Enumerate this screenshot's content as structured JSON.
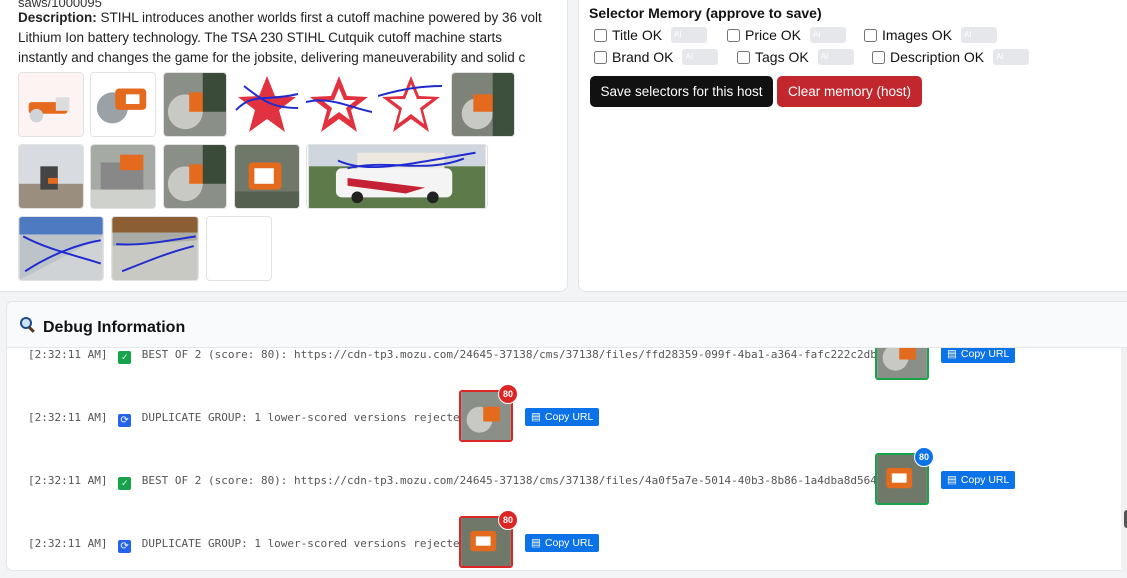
{
  "product": {
    "crop_line": "saws/1000095",
    "description_label": "Description:",
    "description_text": " STIHL introduces another worlds first a cutoff machine powered by 36 volt Lithium Ion battery technology. The TSA 230 STIHL Cutquik cutoff machine starts instantly and changes the game for the jobsite, delivering maneuverability and solid c"
  },
  "selector_memory": {
    "title": "Selector Memory (approve to save)",
    "checks": [
      {
        "label": "Title OK",
        "badge": "AI"
      },
      {
        "label": "Price OK",
        "badge": "AI"
      },
      {
        "label": "Images OK",
        "badge": "AI"
      },
      {
        "label": "Brand OK",
        "badge": "AI"
      },
      {
        "label": "Tags OK",
        "badge": "AI"
      },
      {
        "label": "Description OK",
        "badge": "AI"
      }
    ],
    "save_label": "Save selectors for this host",
    "clear_label": "Clear memory (host)"
  },
  "debug": {
    "title": "Debug Information",
    "icon": "magnifier-icon",
    "logs": [
      {
        "time": "[2:32:11 AM]",
        "icon": "check-icon",
        "text": "BEST OF 2 (score: 80): https://cdn-tp3.mozu.com/24645-37138/cms/37138/files/ffd28359-099f-4ba1-a364-fafc222c2db5",
        "score": "80",
        "copy": "Copy URL"
      },
      {
        "time": "[2:32:11 AM]",
        "icon": "refresh-icon",
        "text": "DUPLICATE GROUP: 1 lower-scored versions rejected",
        "score": "80",
        "copy": "Copy URL"
      },
      {
        "time": "[2:32:11 AM]",
        "icon": "check-icon",
        "text": "BEST OF 2 (score: 80): https://cdn-tp3.mozu.com/24645-37138/cms/37138/files/4a0f5a7e-5014-40b3-8b86-1a4dba8d564b",
        "score": "80",
        "copy": "Copy URL"
      },
      {
        "time": "[2:32:11 AM]",
        "icon": "refresh-icon",
        "text": "DUPLICATE GROUP: 1 lower-scored versions rejected",
        "score": "80",
        "copy": "Copy URL"
      }
    ]
  },
  "colors": {
    "save": "#111111",
    "clear": "#c1272d",
    "accepted": "#16a34a",
    "rejected": "#dc2626",
    "copy": "#0b72e7"
  }
}
